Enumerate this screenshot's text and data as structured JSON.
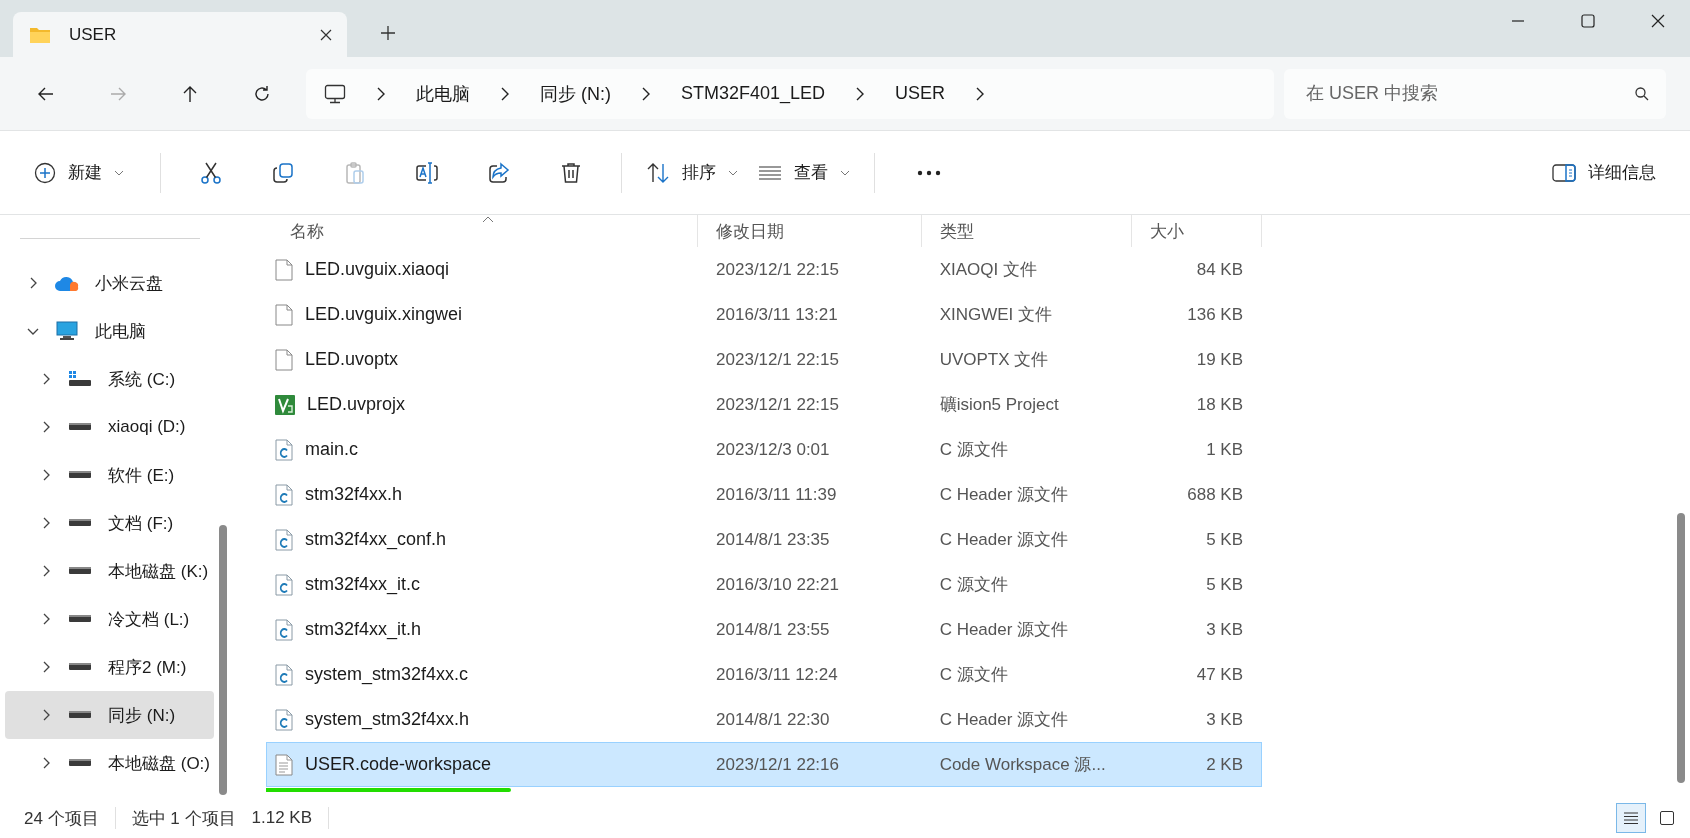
{
  "tabs": [
    {
      "title": "USER",
      "selected": true
    }
  ],
  "address_bar": {
    "crumbs": [
      "此电脑",
      "同步 (N:)",
      "STM32F401_LED",
      "USER"
    ]
  },
  "search": {
    "placeholder": "在 USER 中搜索"
  },
  "nav_buttons": [
    {
      "kind": "back",
      "disabled": false
    },
    {
      "kind": "forward",
      "disabled": true
    },
    {
      "kind": "up",
      "disabled": false
    },
    {
      "kind": "refresh",
      "disabled": false
    }
  ],
  "toolbar": {
    "new_label": "新建",
    "actions": [
      {
        "kind": "cut",
        "disabled": false
      },
      {
        "kind": "copy",
        "disabled": false
      },
      {
        "kind": "paste",
        "disabled": true
      },
      {
        "kind": "rename",
        "disabled": false
      },
      {
        "kind": "share",
        "disabled": false
      },
      {
        "kind": "delete",
        "disabled": false
      }
    ],
    "sort_label": "排序",
    "view_label": "查看",
    "details_label": "详细信息"
  },
  "sidebar": {
    "items": [
      {
        "label": "小米云盘",
        "kind": "cloud",
        "expanded": false,
        "selected": false
      },
      {
        "label": "此电脑",
        "kind": "pc",
        "expanded": true,
        "selected": false,
        "children": [
          {
            "label": "系统 (C:)",
            "kind": "system-drive",
            "expanded": false,
            "selected": false
          },
          {
            "label": "xiaoqi (D:)",
            "kind": "drive",
            "expanded": false,
            "selected": false
          },
          {
            "label": "软件 (E:)",
            "kind": "drive",
            "expanded": false,
            "selected": false
          },
          {
            "label": "文档 (F:)",
            "kind": "drive",
            "expanded": false,
            "selected": false
          },
          {
            "label": "本地磁盘 (K:)",
            "kind": "drive",
            "expanded": false,
            "selected": false
          },
          {
            "label": "冷文档 (L:)",
            "kind": "drive",
            "expanded": false,
            "selected": false
          },
          {
            "label": "程序2 (M:)",
            "kind": "drive",
            "expanded": false,
            "selected": false
          },
          {
            "label": "同步 (N:)",
            "kind": "drive",
            "expanded": false,
            "selected": true
          },
          {
            "label": "本地磁盘 (O:)",
            "kind": "drive",
            "expanded": false,
            "selected": false
          }
        ]
      }
    ]
  },
  "table": {
    "columns": [
      {
        "label": "名称",
        "sorted": true
      },
      {
        "label": "修改日期",
        "sorted": false
      },
      {
        "label": "类型",
        "sorted": false
      },
      {
        "label": "大小",
        "sorted": false
      }
    ],
    "rows": [
      {
        "name": "LED.uvguix.xiaoqi",
        "kind": "file",
        "date": "2023/12/1 22:15",
        "type": "XIAOQI 文件",
        "size": "84 KB",
        "selected": false,
        "marked": false
      },
      {
        "name": "LED.uvguix.xingwei",
        "kind": "file",
        "date": "2016/3/11 13:21",
        "type": "XINGWEI 文件",
        "size": "136 KB",
        "selected": false,
        "marked": false
      },
      {
        "name": "LED.uvoptx",
        "kind": "file",
        "date": "2023/12/1 22:15",
        "type": "UVOPTX 文件",
        "size": "19 KB",
        "selected": false,
        "marked": false
      },
      {
        "name": "LED.uvprojx",
        "kind": "keil",
        "date": "2023/12/1 22:15",
        "type": "礦ision5 Project",
        "size": "18 KB",
        "selected": false,
        "marked": false
      },
      {
        "name": "main.c",
        "kind": "c",
        "date": "2023/12/3 0:01",
        "type": "C 源文件",
        "size": "1 KB",
        "selected": false,
        "marked": false
      },
      {
        "name": "stm32f4xx.h",
        "kind": "c",
        "date": "2016/3/11 11:39",
        "type": "C Header 源文件",
        "size": "688 KB",
        "selected": false,
        "marked": false
      },
      {
        "name": "stm32f4xx_conf.h",
        "kind": "c",
        "date": "2014/8/1 23:35",
        "type": "C Header 源文件",
        "size": "5 KB",
        "selected": false,
        "marked": false
      },
      {
        "name": "stm32f4xx_it.c",
        "kind": "c",
        "date": "2016/3/10 22:21",
        "type": "C 源文件",
        "size": "5 KB",
        "selected": false,
        "marked": false
      },
      {
        "name": "stm32f4xx_it.h",
        "kind": "c",
        "date": "2014/8/1 23:55",
        "type": "C Header 源文件",
        "size": "3 KB",
        "selected": false,
        "marked": false
      },
      {
        "name": "system_stm32f4xx.c",
        "kind": "c",
        "date": "2016/3/11 12:24",
        "type": "C 源文件",
        "size": "47 KB",
        "selected": false,
        "marked": false
      },
      {
        "name": "system_stm32f4xx.h",
        "kind": "c",
        "date": "2014/8/1 22:30",
        "type": "C Header 源文件",
        "size": "3 KB",
        "selected": false,
        "marked": false
      },
      {
        "name": "USER.code-workspace",
        "kind": "text",
        "date": "2023/12/1 22:16",
        "type": "Code Workspace 源...",
        "size": "2 KB",
        "selected": true,
        "marked": true
      }
    ]
  },
  "status_bar": {
    "count": "24 个项目",
    "selection": "选中 1 个项目",
    "size": "1.12 KB",
    "views": [
      {
        "kind": "details",
        "selected": true
      },
      {
        "kind": "tiles",
        "selected": false
      }
    ]
  }
}
